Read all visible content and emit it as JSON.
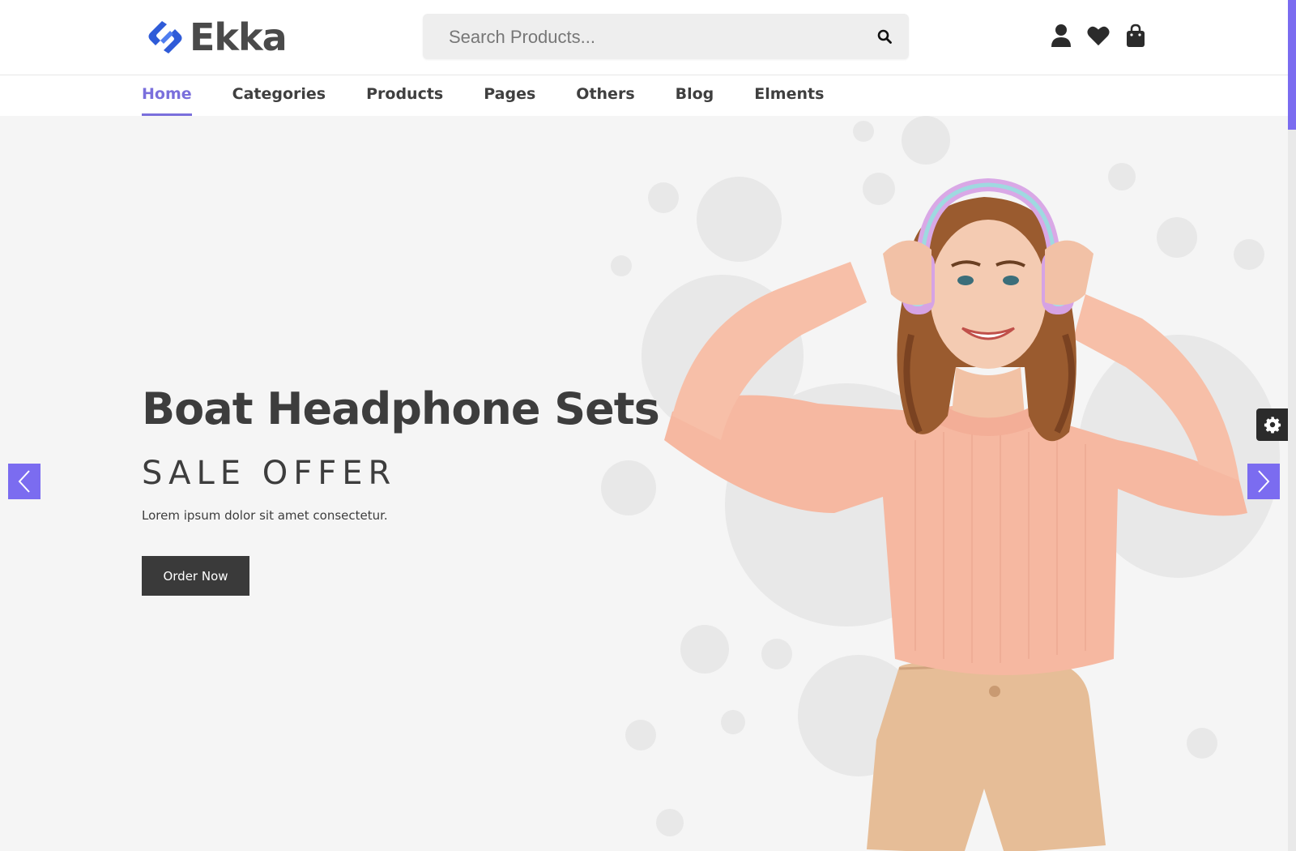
{
  "brand": {
    "name": "Ekka",
    "accent": "#7a6fdc",
    "logo_blue": "#2f5bd8"
  },
  "search": {
    "placeholder": "Search Products...",
    "value": ""
  },
  "header_icons": [
    "user-icon",
    "heart-icon",
    "shopping-bag-icon"
  ],
  "nav": {
    "items": [
      {
        "label": "Home",
        "active": true
      },
      {
        "label": "Categories"
      },
      {
        "label": "Products"
      },
      {
        "label": "Pages"
      },
      {
        "label": "Others"
      },
      {
        "label": "Blog"
      },
      {
        "label": "Elments"
      }
    ]
  },
  "hero": {
    "title": "Boat Headphone Sets",
    "subtitle": "SALE OFFER",
    "text": "Lorem ipsum dolor sit amet consectetur.",
    "button": "Order Now",
    "arrow_color": "#7b6cf0"
  },
  "widgets": {
    "settings_icon": "gear-icon"
  }
}
